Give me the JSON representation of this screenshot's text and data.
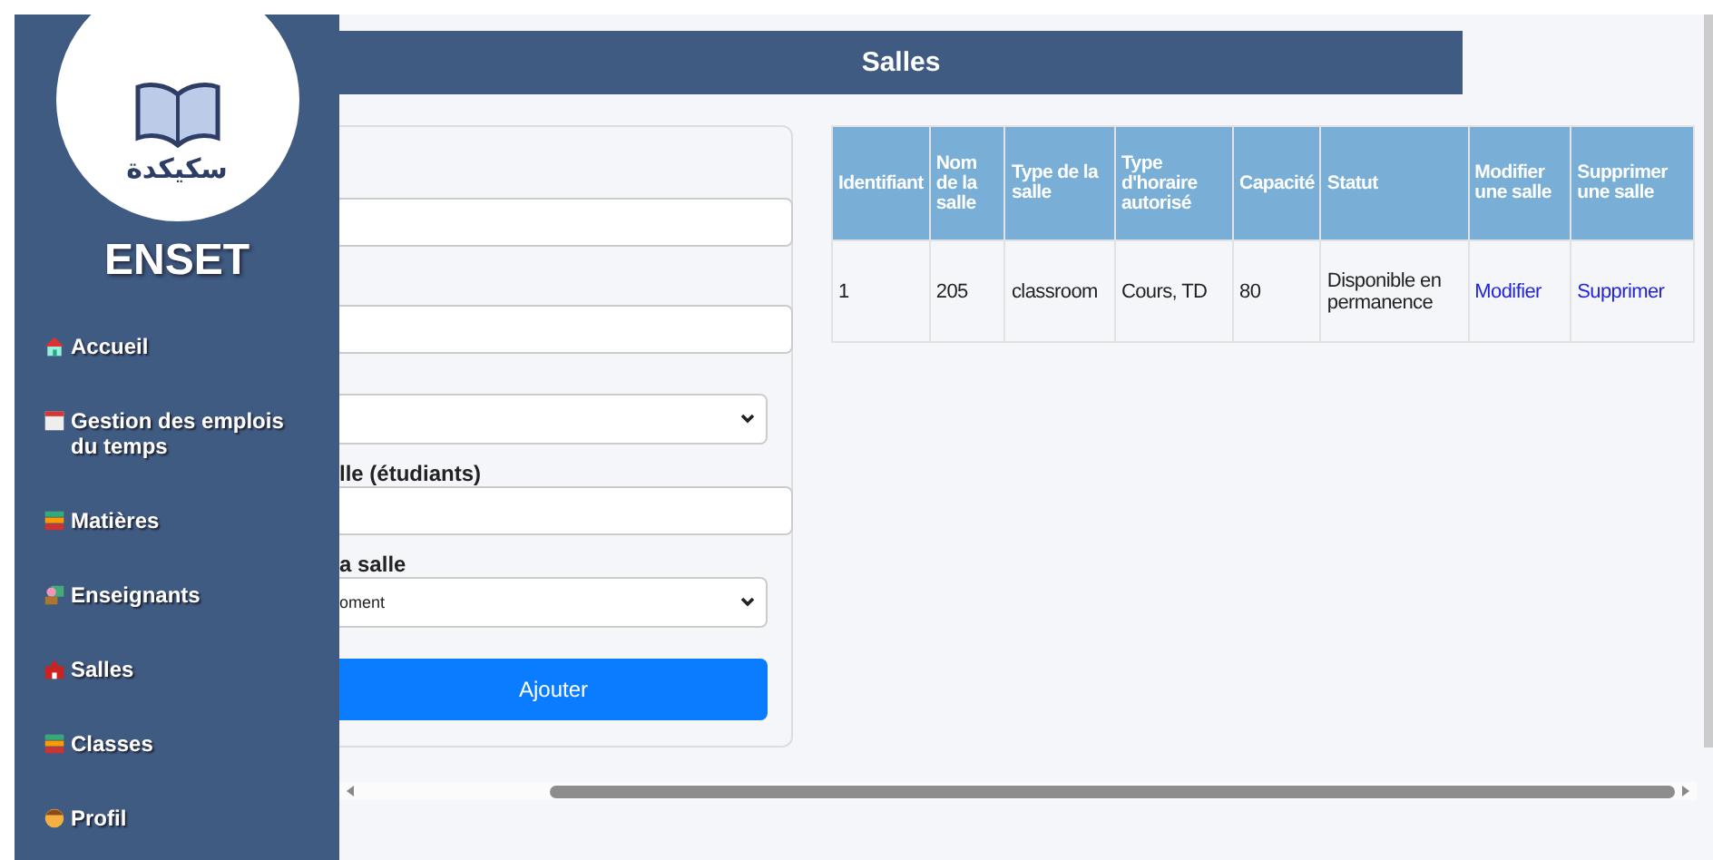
{
  "logo": {
    "caption": "سكيكدة"
  },
  "brand": "ENSET",
  "nav": [
    {
      "label": "Accueil"
    },
    {
      "label": "Gestion des emplois du temps"
    },
    {
      "label": "Matières"
    },
    {
      "label": "Enseignants"
    },
    {
      "label": "Salles"
    },
    {
      "label": "Classes"
    },
    {
      "label": "Profil"
    }
  ],
  "page_title": "Salles",
  "form": {
    "fields": [
      {
        "kind": "text"
      },
      {
        "kind": "text"
      },
      {
        "kind": "select"
      },
      {
        "kind": "text",
        "label": "lle (étudiants)"
      },
      {
        "kind": "select",
        "label": "a salle",
        "value": "oment"
      }
    ],
    "button": "Ajouter"
  },
  "table": {
    "columns": [
      "Identifiant",
      "Nom de la salle",
      "Type de la salle",
      "Type d'horaire autorisé",
      "Capacité",
      "Statut",
      "Modifier une salle",
      "Supprimer une salle"
    ],
    "rows": [
      {
        "cells": [
          {
            "kind": "text",
            "text": "1"
          },
          {
            "kind": "text",
            "text": "205"
          },
          {
            "kind": "text",
            "text": "classroom"
          },
          {
            "kind": "text",
            "text": "Cours, TD"
          },
          {
            "kind": "text",
            "text": "80"
          },
          {
            "kind": "text",
            "text": "Disponible en permanence"
          },
          {
            "kind": "link",
            "text": "Modifier"
          },
          {
            "kind": "link",
            "text": "Supprimer"
          }
        ]
      }
    ]
  }
}
